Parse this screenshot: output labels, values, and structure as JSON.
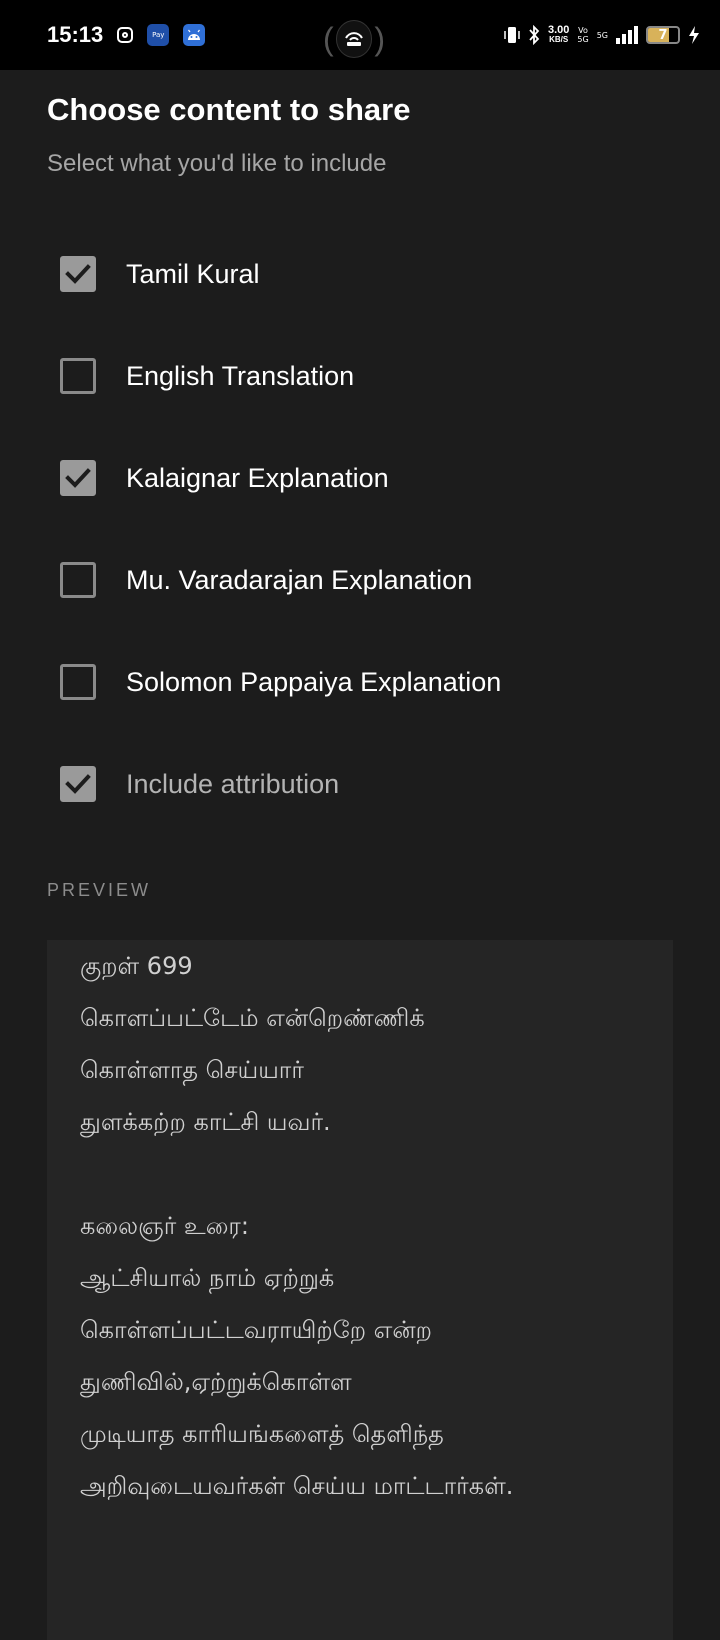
{
  "status_bar": {
    "time": "15:13",
    "badge_1": "Pay",
    "speed_value": "3.00",
    "speed_unit": "KB/S",
    "vo_top": "Vo",
    "vo_bottom": "5G",
    "network": "5G",
    "battery": "7",
    "battery_level": 0.7,
    "accent": "#2f6fd6"
  },
  "dialog": {
    "title": "Choose content to share",
    "subtitle": "Select what you'd like to include",
    "options": [
      {
        "label": "Tamil Kural",
        "checked": true
      },
      {
        "label": "English Translation",
        "checked": false
      },
      {
        "label": "Kalaignar Explanation",
        "checked": true
      },
      {
        "label": "Mu. Varadarajan Explanation",
        "checked": false
      },
      {
        "label": "Solomon Pappaiya Explanation",
        "checked": false
      },
      {
        "label": "Include attribution",
        "checked": true
      }
    ]
  },
  "preview": {
    "heading": "PREVIEW",
    "lines": [
      "குறள் 699",
      "கொளப்பட்டேம் என்றெண்ணிக்",
      "கொள்ளாத செய்யார்",
      "துளக்கற்ற காட்சி யவர்.",
      "",
      "கலைஞர் உரை:",
      "ஆட்சியால் நாம் ஏற்றுக்",
      "கொள்ளப்பட்டவராயிற்றே  என்ற",
      "துணிவில்,ஏற்றுக்கொள்ள",
      "முடியாத   காரியங்களைத்   தெளிந்த",
      "அறிவுடையவர்கள் செய்ய மாட்டார்கள்."
    ]
  }
}
